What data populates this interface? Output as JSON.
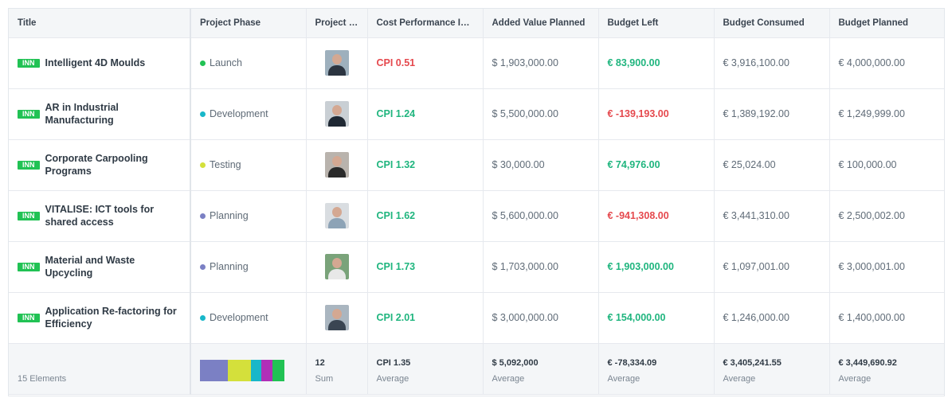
{
  "columns": {
    "title": "Title",
    "project_phase": "Project Phase",
    "project_manager": "Project M...",
    "cpi": "Cost Performance In...",
    "added_value_planned": "Added Value Planned",
    "budget_left": "Budget Left",
    "budget_consumed": "Budget Consumed",
    "budget_planned": "Budget Planned"
  },
  "rows": [
    {
      "badge": "INN",
      "title": "Intelligent 4D Moulds",
      "phase": "Launch",
      "phase_color": "#21c254",
      "cpi": "CPI 0.51",
      "cpi_status": "neg",
      "added_value": "$ 1,903,000.00",
      "budget_left": "€ 83,900.00",
      "budget_left_status": "pos",
      "budget_consumed": "€ 3,916,100.00",
      "budget_planned": "€ 4,000,000.00",
      "avatar_shirt": "#2b3440",
      "avatar_bg": "#9eb0bd"
    },
    {
      "badge": "INN",
      "title": "AR in Industrial Manufacturing",
      "phase": "Development",
      "phase_color": "#18b7c9",
      "cpi": "CPI 1.24",
      "cpi_status": "pos",
      "added_value": "$ 5,500,000.00",
      "budget_left": "€ -139,193.00",
      "budget_left_status": "neg",
      "budget_consumed": "€ 1,389,192.00",
      "budget_planned": "€ 1,249,999.00",
      "avatar_shirt": "#1f2833",
      "avatar_bg": "#c9cfd4"
    },
    {
      "badge": "INN",
      "title": "Corporate Carpooling Programs",
      "phase": "Testing",
      "phase_color": "#d4e03b",
      "cpi": "CPI 1.32",
      "cpi_status": "pos",
      "added_value": "$ 30,000.00",
      "budget_left": "€ 74,976.00",
      "budget_left_status": "pos",
      "budget_consumed": "€ 25,024.00",
      "budget_planned": "€ 100,000.00",
      "avatar_shirt": "#2a2a2a",
      "avatar_bg": "#b9b3ad"
    },
    {
      "badge": "INN",
      "title": "VITALISE: ICT tools for shared access",
      "phase": "Planning",
      "phase_color": "#7b80c4",
      "cpi": "CPI 1.62",
      "cpi_status": "pos",
      "added_value": "$ 5,600,000.00",
      "budget_left": "€ -941,308.00",
      "budget_left_status": "neg",
      "budget_consumed": "€ 3,441,310.00",
      "budget_planned": "€ 2,500,002.00",
      "avatar_shirt": "#8da3b6",
      "avatar_bg": "#d9dde1"
    },
    {
      "badge": "INN",
      "title": "Material and Waste Upcycling",
      "phase": "Planning",
      "phase_color": "#7b80c4",
      "cpi": "CPI 1.73",
      "cpi_status": "pos",
      "added_value": "$ 1,703,000.00",
      "budget_left": "€ 1,903,000.00",
      "budget_left_status": "pos",
      "budget_consumed": "€ 1,097,001.00",
      "budget_planned": "€ 3,000,001.00",
      "avatar_shirt": "#e8e8e8",
      "avatar_bg": "#7aa37a"
    },
    {
      "badge": "INN",
      "title": "Application Re-factoring for Efficiency",
      "phase": "Development",
      "phase_color": "#18b7c9",
      "cpi": "CPI 2.01",
      "cpi_status": "pos",
      "added_value": "$ 3,000,000.00",
      "budget_left": "€ 154,000.00",
      "budget_left_status": "pos",
      "budget_consumed": "€ 1,246,000.00",
      "budget_planned": "€ 1,400,000.00",
      "avatar_shirt": "#3a4552",
      "avatar_bg": "#aab6c0"
    }
  ],
  "footer": {
    "elements": "15 Elements",
    "phase_bar": [
      {
        "color": "#7b80c4",
        "fraction": 0.33
      },
      {
        "color": "#d4e03b",
        "fraction": 0.27
      },
      {
        "color": "#18b7c9",
        "fraction": 0.13
      },
      {
        "color": "#b02fb8",
        "fraction": 0.13
      },
      {
        "color": "#21c254",
        "fraction": 0.14
      }
    ],
    "pm_value": "12",
    "pm_label": "Sum",
    "cpi_value": "CPI 1.35",
    "cpi_label": "Average",
    "avp_value": "$ 5,092,000",
    "avp_label": "Average",
    "bl_value": "€ -78,334.09",
    "bl_label": "Average",
    "bc_value": "€ 3,405,241.55",
    "bc_label": "Average",
    "bp_value": "€ 3,449,690.92",
    "bp_label": "Average"
  }
}
